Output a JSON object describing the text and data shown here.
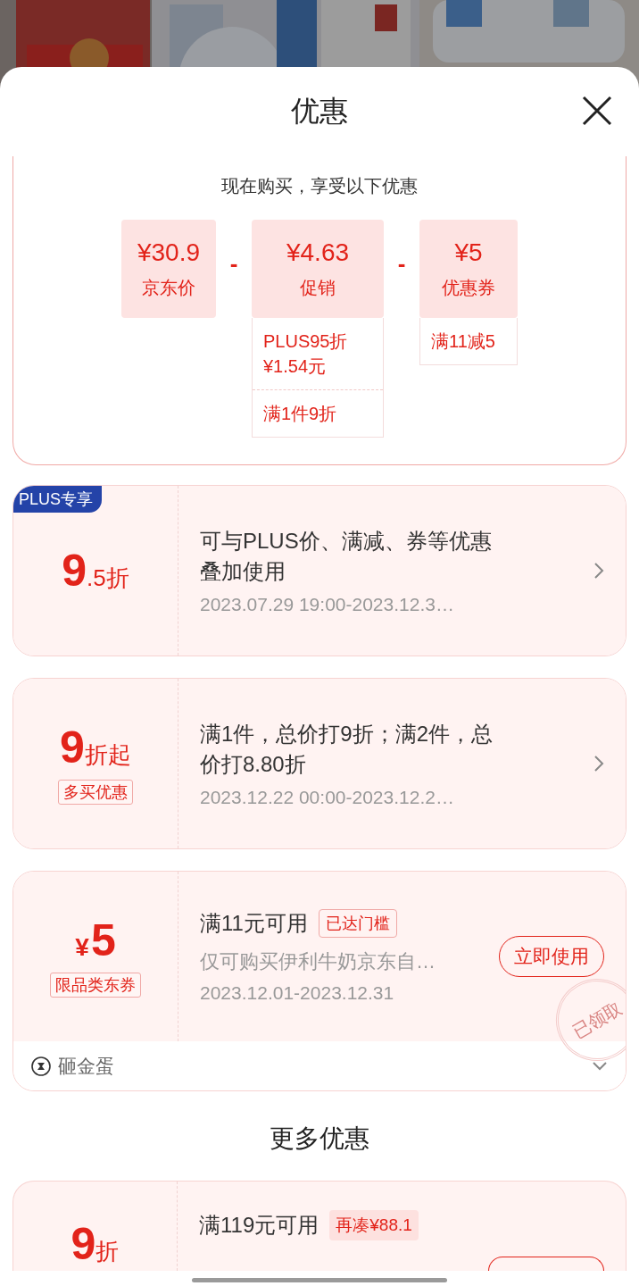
{
  "sheet": {
    "title": "优惠"
  },
  "summary": {
    "heading": "现在购买，享受以下优惠",
    "items": [
      {
        "price": "¥30.9",
        "label": "京东价"
      },
      {
        "price": "¥4.63",
        "label": "促销",
        "details": [
          "PLUS95折\n¥1.54元",
          "满1件9折"
        ]
      },
      {
        "price": "¥5",
        "label": "优惠券",
        "details": [
          "满11减5"
        ]
      }
    ],
    "operators": [
      "-",
      "-"
    ]
  },
  "offers": [
    {
      "kind": "discount",
      "badge": "PLUS专享",
      "value": "9",
      "suffix": ".5折",
      "description": "可与PLUS价、满减、券等优惠叠加使用",
      "period": "2023.07.29 19:00-2023.12.3…"
    },
    {
      "kind": "discount",
      "value": "9",
      "suffix": "折起",
      "tag": "多买优惠",
      "description": "满1件，总价打9折；满2件，总价打8.80折",
      "period": "2023.12.22 00:00-2023.12.2…"
    },
    {
      "kind": "coupon",
      "currency": "¥",
      "value": "5",
      "tag": "限品类东券",
      "title": "满11元可用",
      "status": "已达门槛",
      "description": "仅可购买伊利牛奶京东自…",
      "period": "2023.12.01-2023.12.31",
      "action": "立即使用",
      "stamp": "已领取",
      "footer": "砸金蛋",
      "expanded": false
    }
  ],
  "more_offers": {
    "heading": "更多优惠",
    "items": [
      {
        "kind": "coupon",
        "value": "9",
        "suffix": "折",
        "title": "满119元可用",
        "note": "再凑¥88.1"
      }
    ]
  }
}
